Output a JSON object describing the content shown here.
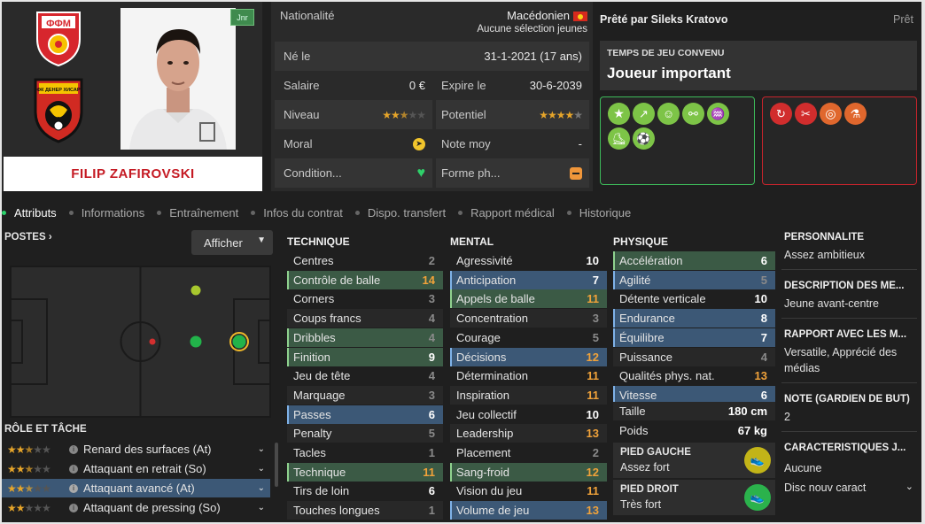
{
  "player": {
    "name": "FILIP ZAFIROVSKI",
    "badge": "Jnr",
    "nation_crest_text": "ФФМ",
    "club_crest_text": "ФК ДЕНЕР ХИСАР"
  },
  "info": {
    "nationality_label": "Nationalité",
    "nationality_value": "Macédonien",
    "nationality_sub": "Aucune sélection jeunes",
    "born_label": "Né le",
    "born_value": "31-1-2021 (17 ans)",
    "salary_label": "Salaire",
    "salary_value": "0 €",
    "expires_label": "Expire le",
    "expires_value": "30-6-2039",
    "level_label": "Niveau",
    "level_stars": 2.5,
    "potential_label": "Potentiel",
    "potential_stars": 4.5,
    "morale_label": "Moral",
    "avg_label": "Note moy",
    "avg_value": "-",
    "condition_label": "Condition...",
    "form_label": "Forme ph..."
  },
  "loan": {
    "label": "Prêté par Sileks Kratovo",
    "status": "Prêt",
    "playing_time_label": "TEMPS DE JEU CONVENU",
    "playing_time_value": "Joueur important"
  },
  "tabs": [
    "Attributs",
    "Informations",
    "Entraînement",
    "Infos du contrat",
    "Dispo. transfert",
    "Rapport médical",
    "Historique"
  ],
  "positions": {
    "title": "POSTES",
    "show_button": "Afficher"
  },
  "roles": {
    "title": "RÔLE ET TÂCHE",
    "items": [
      {
        "label": "Renard des surfaces (At)",
        "stars": 2.5
      },
      {
        "label": "Attaquant en retrait (So)",
        "stars": 2.5
      },
      {
        "label": "Attaquant avancé (At)",
        "stars": 2.5
      },
      {
        "label": "Attaquant de pressing (So)",
        "stars": 2
      }
    ]
  },
  "technique": {
    "title": "TECHNIQUE",
    "attrs": [
      {
        "name": "Centres",
        "value": "2"
      },
      {
        "name": "Contrôle de balle",
        "value": "14"
      },
      {
        "name": "Corners",
        "value": "3"
      },
      {
        "name": "Coups francs",
        "value": "4"
      },
      {
        "name": "Dribbles",
        "value": "4"
      },
      {
        "name": "Finition",
        "value": "9"
      },
      {
        "name": "Jeu de tête",
        "value": "4"
      },
      {
        "name": "Marquage",
        "value": "3"
      },
      {
        "name": "Passes",
        "value": "6"
      },
      {
        "name": "Penalty",
        "value": "5"
      },
      {
        "name": "Tacles",
        "value": "1"
      },
      {
        "name": "Technique",
        "value": "11"
      },
      {
        "name": "Tirs de loin",
        "value": "6"
      },
      {
        "name": "Touches longues",
        "value": "1"
      }
    ]
  },
  "mental": {
    "title": "MENTAL",
    "attrs": [
      {
        "name": "Agressivité",
        "value": "10"
      },
      {
        "name": "Anticipation",
        "value": "7"
      },
      {
        "name": "Appels de balle",
        "value": "11"
      },
      {
        "name": "Concentration",
        "value": "3"
      },
      {
        "name": "Courage",
        "value": "5"
      },
      {
        "name": "Décisions",
        "value": "12"
      },
      {
        "name": "Détermination",
        "value": "11"
      },
      {
        "name": "Inspiration",
        "value": "11"
      },
      {
        "name": "Jeu collectif",
        "value": "10"
      },
      {
        "name": "Leadership",
        "value": "13"
      },
      {
        "name": "Placement",
        "value": "2"
      },
      {
        "name": "Sang-froid",
        "value": "12"
      },
      {
        "name": "Vision du jeu",
        "value": "11"
      },
      {
        "name": "Volume de jeu",
        "value": "13"
      }
    ]
  },
  "physique": {
    "title": "PHYSIQUE",
    "attrs": [
      {
        "name": "Accélération",
        "value": "6"
      },
      {
        "name": "Agilité",
        "value": "5"
      },
      {
        "name": "Détente verticale",
        "value": "10"
      },
      {
        "name": "Endurance",
        "value": "8"
      },
      {
        "name": "Équilibre",
        "value": "7"
      },
      {
        "name": "Puissance",
        "value": "4"
      },
      {
        "name": "Qualités phys. nat.",
        "value": "13"
      },
      {
        "name": "Vitesse",
        "value": "6"
      }
    ],
    "height_label": "Taille",
    "height_value": "180 cm",
    "weight_label": "Poids",
    "weight_value": "67 kg"
  },
  "feet": {
    "left_label": "PIED GAUCHE",
    "left_value": "Assez fort",
    "right_label": "PIED DROIT",
    "right_value": "Très fort"
  },
  "side": {
    "personality_label": "PERSONNALITÉ",
    "personality_value": "Assez ambitieux",
    "description_label": "DESCRIPTION DES MÉ...",
    "description_value": "Jeune avant-centre",
    "media_label": "RAPPORT AVEC LES M...",
    "media_value_1": "Versatile, Apprécié des",
    "media_value_2": "médias",
    "gk_label": "NOTE (GARDIEN DE BUT)",
    "gk_value": "2",
    "traits_label": "CARACTÉRISTIQUES J...",
    "traits_value": "Aucune",
    "new_trait": "Disc nouv caract"
  },
  "colors": {
    "accent_orange": "#f0a23a",
    "highlight_blue": "#3c5876",
    "highlight_green": "#3b5a45",
    "name_red": "#c51b24",
    "strength_border": "#3dbb5a",
    "weakness_border": "#c8242c"
  }
}
